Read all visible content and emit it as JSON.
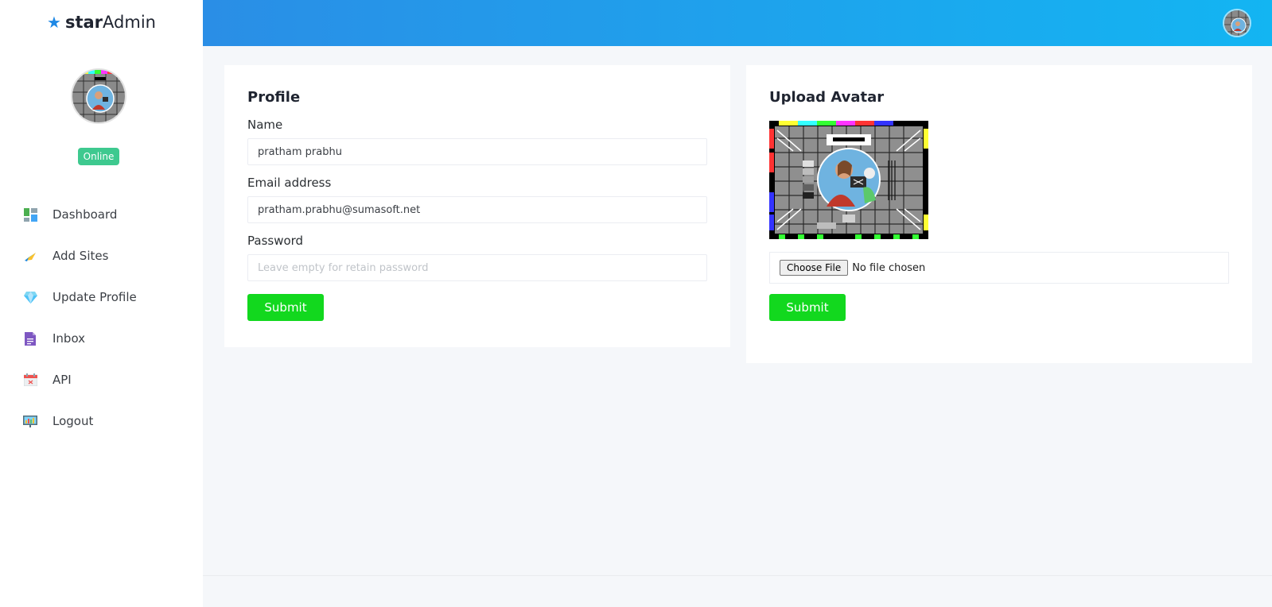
{
  "brand": {
    "bold": "star",
    "light": "Admin",
    "icon": "star-icon",
    "icon_color": "#1e88e5"
  },
  "sidebar": {
    "status": "Online",
    "items": [
      {
        "label": "Dashboard",
        "icon": "dashboard-icon"
      },
      {
        "label": "Add Sites",
        "icon": "add-sites-icon"
      },
      {
        "label": "Update Profile",
        "icon": "diamond-icon"
      },
      {
        "label": "Inbox",
        "icon": "inbox-icon"
      },
      {
        "label": "API",
        "icon": "calendar-icon"
      },
      {
        "label": "Logout",
        "icon": "logout-icon"
      }
    ]
  },
  "header": {
    "avatar": "user-avatar",
    "gradient": [
      "#2a8ee6",
      "#13b5f2"
    ]
  },
  "profile": {
    "title": "Profile",
    "name_label": "Name",
    "name_value": "pratham prabhu",
    "email_label": "Email address",
    "email_value": "pratham.prabhu@sumasoft.net",
    "password_label": "Password",
    "password_placeholder": "Leave empty for retain password",
    "submit_label": "Submit"
  },
  "upload": {
    "title": "Upload Avatar",
    "choose_file_label": "Choose File",
    "file_status": "No file chosen",
    "submit_label": "Submit"
  },
  "colors": {
    "accent": "#12d81e",
    "online": "#3ec98f",
    "text": "#1f2430"
  }
}
